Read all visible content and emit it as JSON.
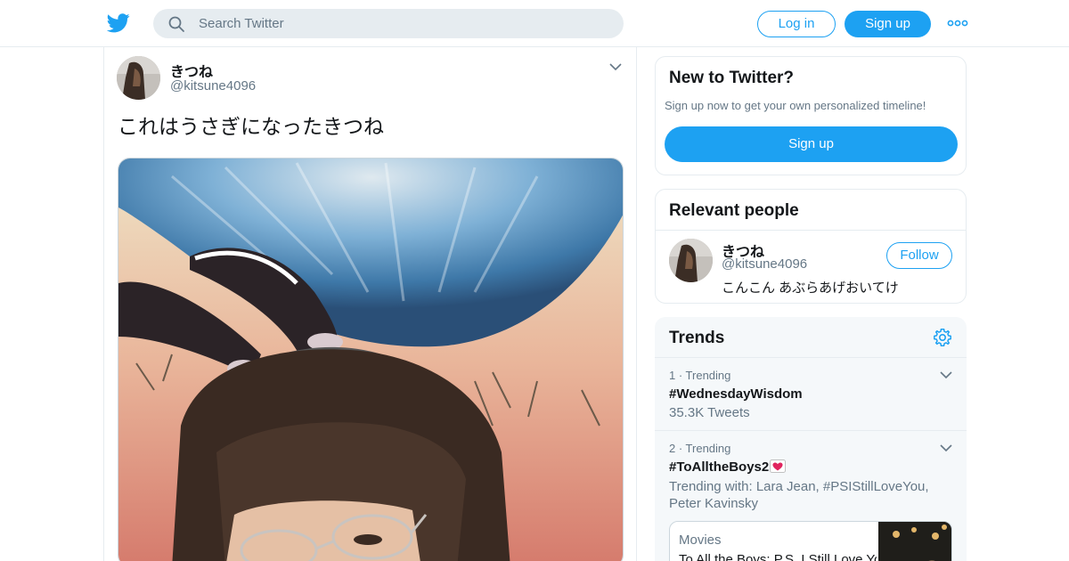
{
  "header": {
    "search_placeholder": "Search Twitter",
    "login_label": "Log in",
    "signup_label": "Sign up",
    "accent_color": "#1da1f2"
  },
  "tweet": {
    "display_name": "きつね",
    "handle": "@kitsune4096",
    "text": "これはうさぎになったきつね"
  },
  "new_to_twitter": {
    "heading": "New to Twitter?",
    "subtext": "Sign up now to get your own personalized timeline!",
    "button_label": "Sign up"
  },
  "relevant_people": {
    "heading": "Relevant people",
    "person": {
      "display_name": "きつね",
      "handle": "@kitsune4096",
      "bio": "こんこん あぶらあげおいてけ",
      "follow_label": "Follow"
    }
  },
  "trends": {
    "heading": "Trends",
    "items": [
      {
        "meta": "1 · Trending",
        "tag": "#WednesdayWisdom",
        "sub": "35.3K Tweets"
      },
      {
        "meta": "2 · Trending",
        "tag": "#ToAlltheBoys2",
        "sub": "Trending with: Lara Jean, #PSIStillLoveYou, Peter Kavinsky"
      }
    ],
    "media_card": {
      "category": "Movies",
      "title": "To All the Boys: P.S. I Still Love You"
    }
  }
}
